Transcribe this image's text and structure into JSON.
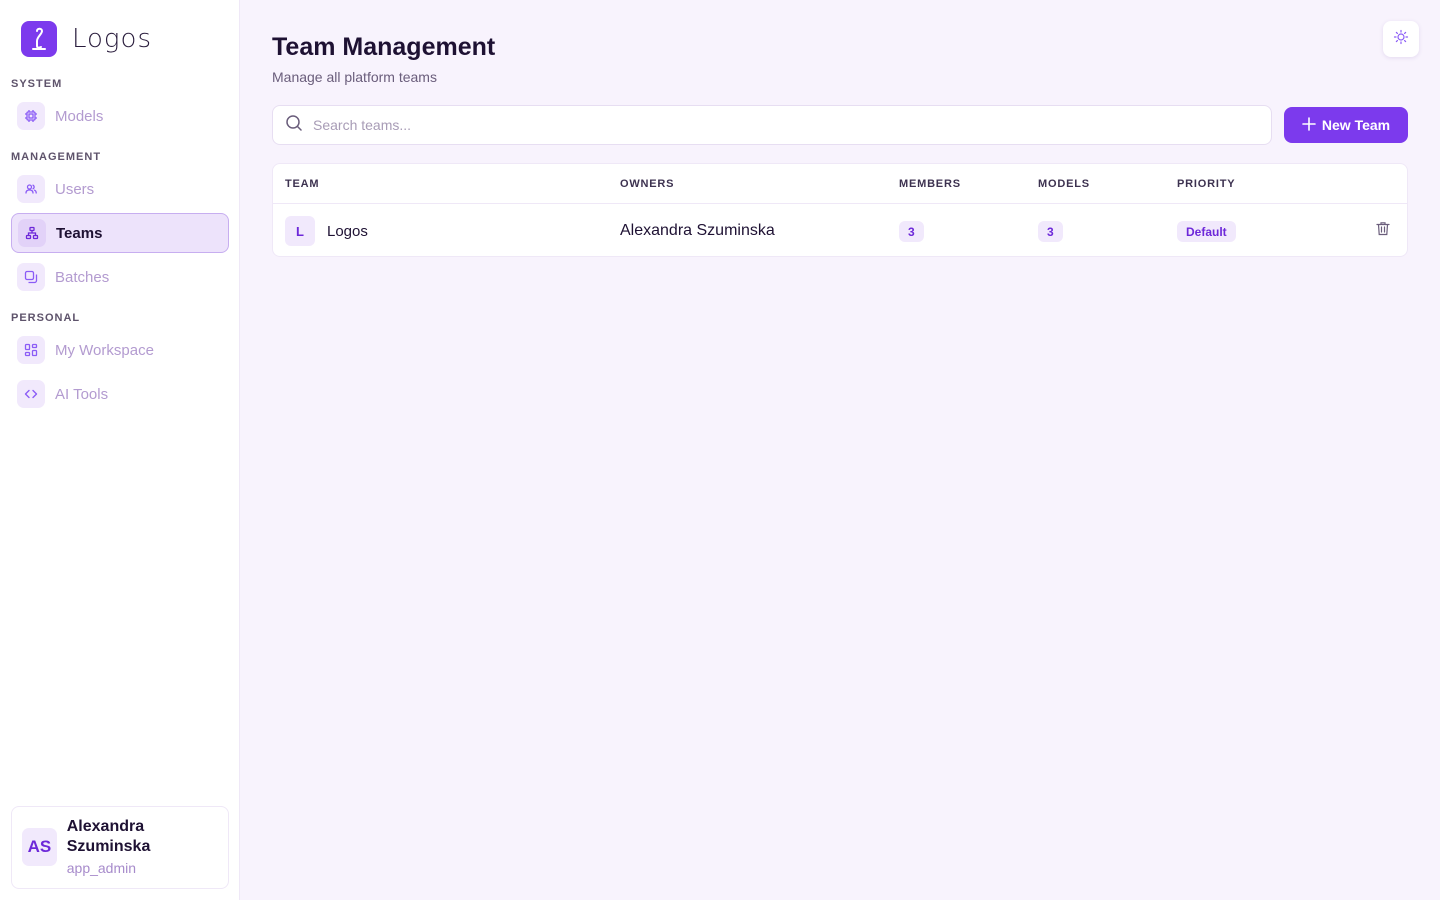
{
  "brand": {
    "name": "Logos",
    "icon": "logo-mark-icon"
  },
  "sidebar": {
    "sections": [
      {
        "label": "SYSTEM"
      },
      {
        "label": "MANAGEMENT"
      },
      {
        "label": "PERSONAL"
      }
    ],
    "items": [
      {
        "label": "Models",
        "icon": "chip-icon",
        "active": false
      },
      {
        "label": "Users",
        "icon": "users-icon",
        "active": false
      },
      {
        "label": "Teams",
        "icon": "org-chart-icon",
        "active": true
      },
      {
        "label": "Batches",
        "icon": "copy-icon",
        "active": false
      },
      {
        "label": "My Workspace",
        "icon": "grid-icon",
        "active": false
      },
      {
        "label": "AI Tools",
        "icon": "code-icon",
        "active": false
      }
    ]
  },
  "user": {
    "initials": "AS",
    "name": "Alexandra Szuminska",
    "role": "app_admin"
  },
  "header": {
    "title": "Team Management",
    "subtitle": "Manage all platform teams"
  },
  "search": {
    "placeholder": "Search teams...",
    "value": ""
  },
  "actions": {
    "new_team_label": "New Team"
  },
  "table": {
    "columns": [
      "TEAM",
      "OWNERS",
      "MEMBERS",
      "MODELS",
      "PRIORITY"
    ],
    "rows": [
      {
        "initial": "L",
        "team": "Logos",
        "owners": "Alexandra Szuminska",
        "members": "3",
        "models": "3",
        "priority": "Default"
      }
    ]
  },
  "colors": {
    "accent": "#7c3aed",
    "background": "#f8f3fd",
    "badge_bg": "#f1e9fc",
    "badge_text": "#6d28d9"
  }
}
